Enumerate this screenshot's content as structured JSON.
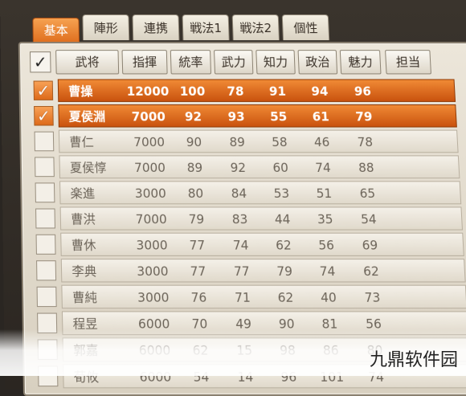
{
  "tabs": [
    "基本",
    "陣形",
    "連携",
    "戦法1",
    "戦法2",
    "個性"
  ],
  "active_tab": 0,
  "header": {
    "check_mark": "✓",
    "columns": [
      "武将",
      "指揮",
      "統率",
      "武力",
      "知力",
      "政治",
      "魅力",
      "担当"
    ]
  },
  "rows": [
    {
      "checked": true,
      "selected": true,
      "name": "曹操",
      "cmd": "12000",
      "lead": "100",
      "war": "78",
      "int": "91",
      "pol": "94",
      "cha": "96"
    },
    {
      "checked": true,
      "selected": true,
      "name": "夏侯淵",
      "cmd": "7000",
      "lead": "92",
      "war": "93",
      "int": "55",
      "pol": "61",
      "cha": "79"
    },
    {
      "checked": false,
      "selected": false,
      "name": "曹仁",
      "cmd": "7000",
      "lead": "90",
      "war": "89",
      "int": "58",
      "pol": "46",
      "cha": "78"
    },
    {
      "checked": false,
      "selected": false,
      "name": "夏侯惇",
      "cmd": "7000",
      "lead": "89",
      "war": "92",
      "int": "60",
      "pol": "74",
      "cha": "88"
    },
    {
      "checked": false,
      "selected": false,
      "name": "楽進",
      "cmd": "3000",
      "lead": "80",
      "war": "84",
      "int": "53",
      "pol": "51",
      "cha": "65"
    },
    {
      "checked": false,
      "selected": false,
      "name": "曹洪",
      "cmd": "7000",
      "lead": "79",
      "war": "83",
      "int": "44",
      "pol": "35",
      "cha": "54"
    },
    {
      "checked": false,
      "selected": false,
      "name": "曹休",
      "cmd": "3000",
      "lead": "77",
      "war": "74",
      "int": "62",
      "pol": "56",
      "cha": "69"
    },
    {
      "checked": false,
      "selected": false,
      "name": "李典",
      "cmd": "3000",
      "lead": "77",
      "war": "77",
      "int": "79",
      "pol": "74",
      "cha": "62"
    },
    {
      "checked": false,
      "selected": false,
      "name": "曹純",
      "cmd": "3000",
      "lead": "76",
      "war": "71",
      "int": "62",
      "pol": "40",
      "cha": "73"
    },
    {
      "checked": false,
      "selected": false,
      "name": "程昱",
      "cmd": "6000",
      "lead": "70",
      "war": "49",
      "int": "90",
      "pol": "81",
      "cha": "56"
    },
    {
      "checked": false,
      "selected": false,
      "name": "郭嘉",
      "cmd": "6000",
      "lead": "62",
      "war": "15",
      "int": "98",
      "pol": "86",
      "cha": "80"
    },
    {
      "checked": false,
      "selected": false,
      "name": "荀攸",
      "cmd": "6000",
      "lead": "54",
      "war": "14",
      "int": "96",
      "pol": "101",
      "cha": "74"
    }
  ],
  "watermark": "九鼎软件园",
  "colors": {
    "accent": "#e07020",
    "selected_row": "#d9601a",
    "panel": "#e6dfd2"
  }
}
